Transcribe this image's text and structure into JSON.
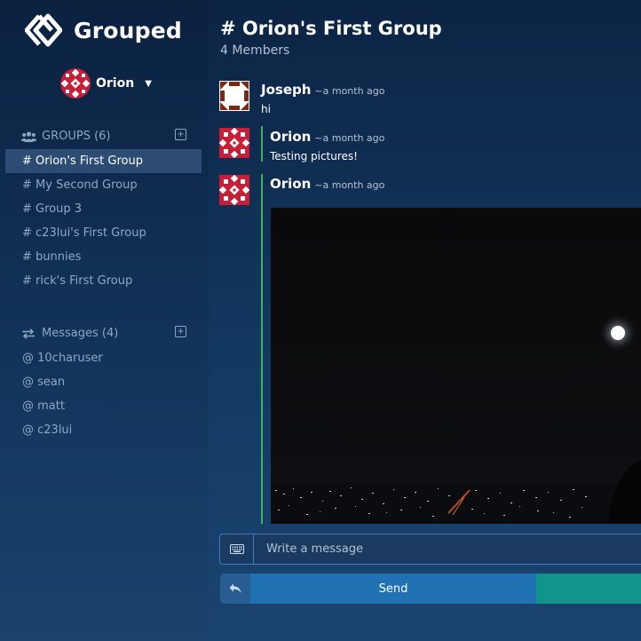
{
  "app": {
    "name": "Grouped"
  },
  "user": {
    "name": "Orion"
  },
  "groups": {
    "header": "GROUPS (6)",
    "items": [
      "# Orion's First Group",
      "# My Second Group",
      "# Group 3",
      "# c23lui's First Group",
      "# bunnies",
      "# rick's First Group"
    ],
    "active_index": 0
  },
  "messages_section": {
    "header": "Messages (4)",
    "items": [
      "@ 10charuser",
      "@ sean",
      "@ matt",
      "@ c23lui"
    ]
  },
  "channel": {
    "title": "# Orion's First Group",
    "members": "4 Members"
  },
  "feed": [
    {
      "author": "Joseph",
      "time": "~a month ago",
      "text": "hi"
    },
    {
      "author": "Orion",
      "time": "~a month ago",
      "text": "Testing pictures!"
    },
    {
      "author": "Orion",
      "time": "~a month ago",
      "text": ""
    }
  ],
  "composer": {
    "placeholder": "Write a message",
    "send_label": "Send"
  },
  "colors": {
    "accent_blue": "#2172b2",
    "accent_teal": "#11948c",
    "thread_line": "#40b15f",
    "active_item": "#2c4c73"
  },
  "icons": [
    "grouped-logo-icon",
    "caret-down-icon",
    "users-icon",
    "plus-square-icon",
    "exchange-icon",
    "keyboard-icon",
    "reply-icon"
  ]
}
